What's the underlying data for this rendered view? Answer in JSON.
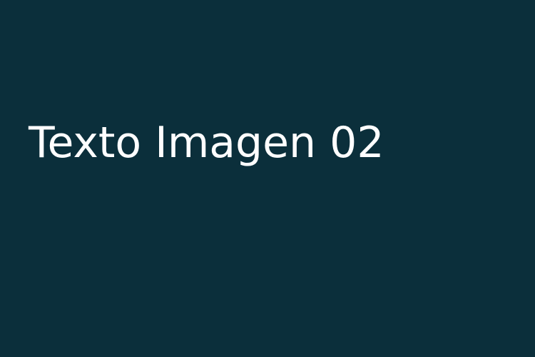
{
  "image": {
    "caption": "Texto Imagen 02",
    "background_color": "#0b2f3b",
    "text_color": "#ffffff"
  }
}
